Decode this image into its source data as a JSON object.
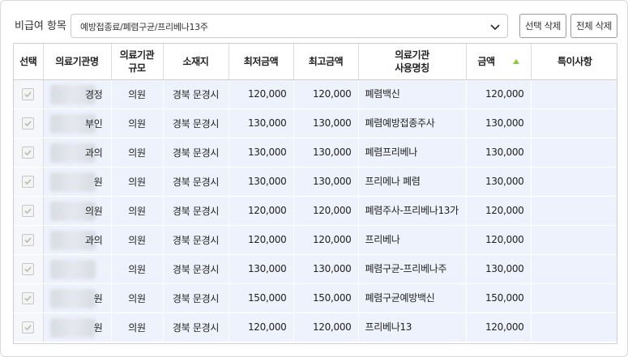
{
  "filter": {
    "label": "비급여 항목",
    "selected": "예방접종료/폐렴구균/프리베나13주"
  },
  "buttons": {
    "delete_selected": "선택 삭제",
    "delete_all": "전체 삭제"
  },
  "table": {
    "headers": {
      "select": "선택",
      "name": "의료기관명",
      "scale_line1": "의료기관",
      "scale_line2": "규모",
      "location": "소재지",
      "min": "최저금액",
      "max": "최고금액",
      "use_line1": "의료기관",
      "use_line2": "사용명칭",
      "amount": "금액",
      "note": "특이사항"
    },
    "rows": [
      {
        "name": "경정",
        "scale": "의원",
        "location": "경북 문경시",
        "min": "120,000",
        "max": "120,000",
        "use": "폐렴백신",
        "amount": "120,000",
        "note": ""
      },
      {
        "name": "부인",
        "scale": "의원",
        "location": "경북 문경시",
        "min": "130,000",
        "max": "130,000",
        "use": "폐렴예방접종주사",
        "amount": "130,000",
        "note": ""
      },
      {
        "name": "과의",
        "scale": "의원",
        "location": "경북 문경시",
        "min": "130,000",
        "max": "130,000",
        "use": "폐렴프리베나",
        "amount": "130,000",
        "note": ""
      },
      {
        "name": "원",
        "scale": "의원",
        "location": "경북 문경시",
        "min": "130,000",
        "max": "130,000",
        "use": "프리메나 폐렴",
        "amount": "130,000",
        "note": ""
      },
      {
        "name": "의원",
        "scale": "의원",
        "location": "경북 문경시",
        "min": "120,000",
        "max": "120,000",
        "use": "폐렴주사-프리베나13가",
        "amount": "120,000",
        "note": ""
      },
      {
        "name": "과의",
        "scale": "의원",
        "location": "경북 문경시",
        "min": "120,000",
        "max": "120,000",
        "use": "프리베나",
        "amount": "120,000",
        "note": ""
      },
      {
        "name": "",
        "scale": "의원",
        "location": "경북 문경시",
        "min": "130,000",
        "max": "130,000",
        "use": "폐렴구균-프리베나주",
        "amount": "130,000",
        "note": ""
      },
      {
        "name": "원",
        "scale": "의원",
        "location": "경북 문경시",
        "min": "150,000",
        "max": "150,000",
        "use": "폐렴구균예방백신",
        "amount": "150,000",
        "note": ""
      },
      {
        "name": "원",
        "scale": "의원",
        "location": "경북 문경시",
        "min": "120,000",
        "max": "120,000",
        "use": "프리베나13",
        "amount": "120,000",
        "note": ""
      }
    ]
  },
  "colors": {
    "row_bg": "#eef2fc",
    "check_bg": "#f6f7fb",
    "sort_arrow": "#8cc63f"
  },
  "icons": {
    "dropdown": "chevron-down-icon",
    "sort": "sort-asc-icon",
    "checkbox": "check-icon"
  }
}
